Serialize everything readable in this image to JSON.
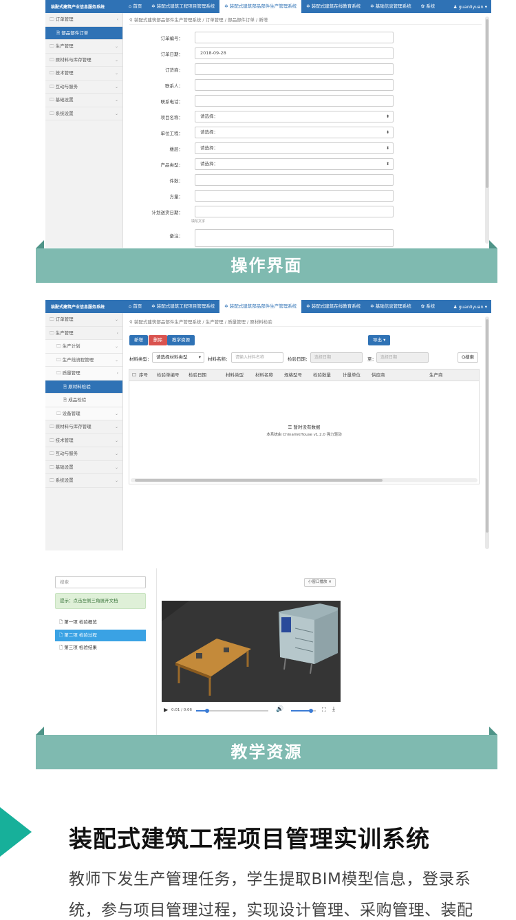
{
  "shot1": {
    "brand": "装配式建筑产业信息服务系统",
    "tabs": [
      "首页",
      "装配式建筑工程项目管理系统",
      "装配式建筑部品部件生产管理系统",
      "装配式建筑在线教育系统",
      "基础信息管理系统",
      "系统"
    ],
    "active_tab": 2,
    "user": "guanliyuan",
    "sidebar": [
      {
        "label": "订单管理",
        "chev": "‹"
      },
      {
        "label": "部品部件订单",
        "active": true
      },
      {
        "label": "生产管理",
        "chev": "⌄"
      },
      {
        "label": "原材料与库存管理",
        "chev": "⌄"
      },
      {
        "label": "技术管理",
        "chev": "⌄"
      },
      {
        "label": "互动与服务",
        "chev": "⌄"
      },
      {
        "label": "基础设置",
        "chev": "⌄"
      },
      {
        "label": "系统设置",
        "chev": "⌄"
      }
    ],
    "breadcrumb": "装配式建筑部品部件生产管理系统 / 订单管理 / 部品部件订单 / 新增",
    "form": [
      {
        "label": "订单编号：",
        "value": ""
      },
      {
        "label": "订单日期：",
        "value": "2018-09-28"
      },
      {
        "label": "订货商：",
        "value": ""
      },
      {
        "label": "联系人：",
        "value": ""
      },
      {
        "label": "联系电话：",
        "value": ""
      },
      {
        "label": "项目名称：",
        "value": "请选择：",
        "select": true
      },
      {
        "label": "单位工程：",
        "value": "请选择：",
        "select": true
      },
      {
        "label": "楼层：",
        "value": "请选择：",
        "select": true
      },
      {
        "label": "产品类型：",
        "value": "请选择：",
        "select": true
      },
      {
        "label": "件数：",
        "value": ""
      },
      {
        "label": "方量：",
        "value": ""
      },
      {
        "label": "计划送货日期：",
        "value": ""
      },
      {
        "label": "备注：",
        "value": ""
      }
    ],
    "hint": "填写文字"
  },
  "banner1": "操作界面",
  "shot2": {
    "brand": "装配式建筑产业信息服务系统",
    "tabs": [
      "首页",
      "装配式建筑工程项目管理系统",
      "装配式建筑部品部件生产管理系统",
      "装配式建筑在线教育系统",
      "基础信息管理系统",
      "系统"
    ],
    "user": "guanliyuan",
    "sidebar": [
      {
        "label": "订单管理",
        "chev": "⌄",
        "level": 0
      },
      {
        "label": "生产管理",
        "chev": "‹",
        "level": 0
      },
      {
        "label": "生产计划",
        "chev": "⌄",
        "level": 1
      },
      {
        "label": "生产线流程管理",
        "chev": "⌄",
        "level": 1
      },
      {
        "label": "质量管理",
        "chev": "‹",
        "level": 1
      },
      {
        "label": "原材料检验",
        "level": 2,
        "active": true
      },
      {
        "label": "成品检验",
        "level": 2
      },
      {
        "label": "设备管理",
        "chev": "⌄",
        "level": 1
      },
      {
        "label": "原材料与库存管理",
        "chev": "⌄",
        "level": 0
      },
      {
        "label": "技术管理",
        "chev": "⌄",
        "level": 0
      },
      {
        "label": "互动与服务",
        "chev": "⌄",
        "level": 0
      },
      {
        "label": "基础设置",
        "chev": "⌄",
        "level": 0
      },
      {
        "label": "系统设置",
        "chev": "⌄",
        "level": 0
      }
    ],
    "breadcrumb": "装配式建筑部品部件生产管理系统 / 生产管理 / 质量管理 / 原材料检验",
    "buttons": {
      "add": "新增",
      "delete": "删除",
      "teach": "教学资源",
      "export": "导出 ▾",
      "search": "Q搜索"
    },
    "filters": {
      "type_label": "材料类型：",
      "type_value": "请选择材料类型",
      "name_label": "材料名称：",
      "name_placeholder": "请输入材料名称",
      "date_label": "检验日期：",
      "date_placeholder": "选择日期",
      "to_label": "至：",
      "to_placeholder": "选择日期"
    },
    "columns": [
      "序号",
      "检验单编号",
      "检验日期",
      "材料类型",
      "材料名称",
      "规格型号",
      "检验数量",
      "计量单位",
      "供应商",
      "生产商"
    ],
    "empty_text": "暂时没有数据",
    "empty_sub": "本系统由 ChinalinkHouse v1.2.0 强力驱动"
  },
  "shot3": {
    "search_placeholder": "搜索",
    "tip": "提示：点击左侧三角展开文档",
    "chapters": [
      "第一项 检验概览",
      "第二项 检验过程",
      "第三项 检验结果"
    ],
    "active_chapter": 1,
    "mini_button": "小窗口播放",
    "time": "0:01 / 0:06",
    "progress": 0.15,
    "volume": 0.8
  },
  "banner2": "教学资源",
  "section": {
    "title": "装配式建筑工程项目管理实训系统",
    "lines": [
      "教师下发生产管理任务，学生提取BIM模型信息，登录系",
      "统，参与项目管理过程，实现设计管理、采购管理、装配"
    ]
  },
  "colors": {
    "primary": "#2f72b5",
    "accent": "#3aa2e4",
    "banner": "#7fbab0",
    "arrow": "#17b09a",
    "danger": "#d9534f"
  }
}
